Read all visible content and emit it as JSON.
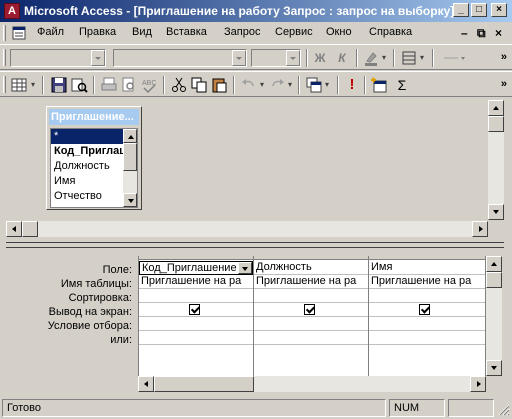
{
  "window": {
    "title": "Microsoft Access - [Приглашение на работу Запрос : запрос на выборку]",
    "app_icon_letter": "A",
    "controls": [
      "_",
      "□",
      "×"
    ]
  },
  "menu": {
    "items": [
      {
        "id": "file",
        "label": "Файл"
      },
      {
        "id": "edit",
        "label": "Правка"
      },
      {
        "id": "view",
        "label": "Вид"
      },
      {
        "id": "insert",
        "label": "Вставка"
      },
      {
        "id": "query",
        "label": "Запрос"
      },
      {
        "id": "tools",
        "label": "Сервис"
      },
      {
        "id": "window",
        "label": "Окно"
      },
      {
        "id": "help",
        "label": "Справка"
      }
    ],
    "mdi_controls": [
      "–",
      "⧉",
      "×"
    ]
  },
  "format_toolbar": {
    "bold_label": "Ж",
    "italic_label": "К",
    "overflow": "»"
  },
  "standard_toolbar": {
    "sigma_label": "Σ",
    "run_label": "!",
    "overflow": "»"
  },
  "table_box": {
    "caption": "Приглашение...",
    "fields": [
      "*",
      "Код_Приглаш",
      "Должность",
      "Имя",
      "Отчество"
    ],
    "selected_index": 0
  },
  "design_grid": {
    "row_labels": [
      "Поле:",
      "Имя таблицы:",
      "Сортировка:",
      "Вывод на экран:",
      "Условие отбора:",
      "или:"
    ],
    "columns": [
      {
        "field": "Код_Приглашение",
        "table": "Приглашение на ра",
        "show": true
      },
      {
        "field": "Должность",
        "table": "Приглашение на ра",
        "show": true
      },
      {
        "field": "Имя",
        "table": "Приглашение на ра",
        "show": true
      }
    ]
  },
  "status": {
    "ready": "Готово",
    "num": "NUM"
  },
  "colors": {
    "titlebar_start": "#0a246a",
    "titlebar_end": "#a6caf0",
    "face": "#d4d0c8",
    "selection": "#0a246a"
  }
}
